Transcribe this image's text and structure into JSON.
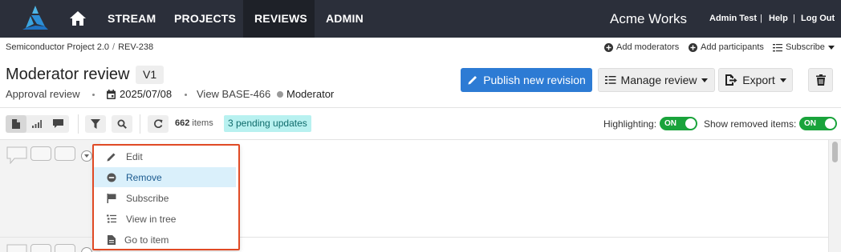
{
  "nav": {
    "links": [
      "STREAM",
      "PROJECTS",
      "REVIEWS",
      "ADMIN"
    ],
    "active": "REVIEWS",
    "brand": "Acme Works",
    "user": "Admin Test",
    "help": "Help",
    "logout": "Log Out",
    "separator": "|"
  },
  "breadcrumb": {
    "project": "Semiconductor Project 2.0",
    "separator": "/",
    "item": "REV-238"
  },
  "header_actions": {
    "add_moderators": "Add moderators",
    "add_participants": "Add participants",
    "subscribe": "Subscribe"
  },
  "review": {
    "title": "Moderator review",
    "version": "V1",
    "type": "Approval review",
    "date": "2025/07/08",
    "view_baseline": "View BASE-466",
    "role": "Moderator"
  },
  "buttons": {
    "publish": "Publish new revision",
    "manage": "Manage review",
    "export": "Export"
  },
  "toolbar": {
    "item_count": "662",
    "items_label": "items",
    "pending": "3 pending updates",
    "highlighting_label": "Highlighting:",
    "highlighting_state": "ON",
    "show_removed_label": "Show removed items:",
    "show_removed_state": "ON"
  },
  "context_menu": {
    "items": [
      {
        "label": "Edit",
        "icon": "pencil-icon"
      },
      {
        "label": "Remove",
        "icon": "minus-circle-icon"
      },
      {
        "label": "Subscribe",
        "icon": "flag-icon"
      },
      {
        "label": "View in tree",
        "icon": "tree-list-icon"
      },
      {
        "label": "Go to item",
        "icon": "document-icon"
      }
    ],
    "highlighted_index": 1
  },
  "colors": {
    "nav_bg": "#2b2f3a",
    "primary": "#2d7bd4",
    "toggle_on": "#19a33b",
    "pending_bg": "#b8f1f0",
    "menu_highlight": "#daf0fb",
    "callout_outline": "#e04a25"
  }
}
